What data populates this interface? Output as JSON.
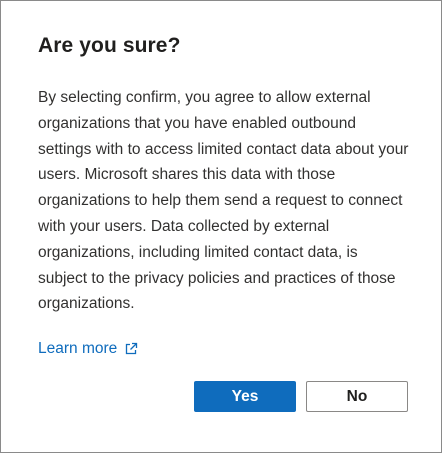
{
  "dialog": {
    "title": "Are you sure?",
    "body": "By selecting confirm, you agree to allow external organizations that you have enabled outbound settings with to access limited contact data about your users. Microsoft shares this data with those organizations to help them send a request to connect with your users. Data collected by external organizations, including limited contact data, is subject to the privacy policies and practices of those organizations.",
    "learn_more_label": "Learn more",
    "learn_more_icon": "external-link-icon",
    "yes_label": "Yes",
    "no_label": "No"
  },
  "colors": {
    "accent": "#0f6cbd",
    "border": "#8a8a8a",
    "text": "#323130"
  }
}
